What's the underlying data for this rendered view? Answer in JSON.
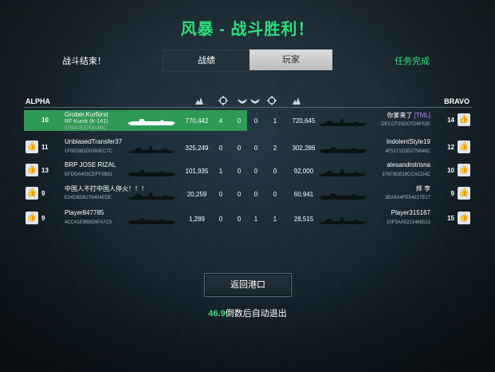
{
  "title": "风暴 - 战斗胜利！",
  "header": {
    "battle_over": "战斗结束！",
    "mission_complete": "任务完成",
    "tabs": [
      "战绩",
      "玩家"
    ]
  },
  "teams": {
    "left": "ALPHA",
    "right": "BRAVO"
  },
  "columns": [
    "damage-icon",
    "crosshair-icon",
    "wings-icon",
    "wings-icon",
    "crosshair-icon",
    "damage-icon"
  ],
  "rows": [
    {
      "left": {
        "rank": "10",
        "name": "Grober.Kurfürst",
        "ship": "RF Kursk (K-141)",
        "id": "676947E2758C69C",
        "score": "770,442",
        "s1": "4",
        "s2": "0"
      },
      "mid": "0",
      "right": {
        "s3": "1",
        "score": "720,645",
        "name": "你爹来了",
        "tag": "[TML]",
        "id": "DECCF25DCFD6F52E",
        "rank": "14"
      }
    },
    {
      "left": {
        "rank": "11",
        "name": "UnbiasedTransfer37",
        "ship": "",
        "id": "1F0ED6DD0390EC7C",
        "score": "325,249",
        "s1": "0",
        "s2": "0"
      },
      "mid": "0",
      "right": {
        "s3": "2",
        "score": "302,286",
        "name": "IndolentStyle19",
        "tag": "",
        "id": "4F5271D3D279848C",
        "rank": "12"
      }
    },
    {
      "left": {
        "rank": "13",
        "name": "BRP JOSE RIZAL",
        "ship": "",
        "id": "EFDDA403CEFF3B81",
        "score": "101,935",
        "s1": "1",
        "s2": "0"
      },
      "mid": "0",
      "right": {
        "s3": "0",
        "score": "92,000",
        "name": "alesandrotrisna",
        "tag": "",
        "id": "37879DE19CCACD4C",
        "rank": "10"
      }
    },
    {
      "left": {
        "rank": "9",
        "name": "中国人不打中国人停火！！！",
        "ship": "",
        "id": "E24D8DB276404EDE",
        "score": "20,259",
        "s1": "0",
        "s2": "0"
      },
      "mid": "0",
      "right": {
        "s3": "0",
        "score": "60,941",
        "name": "烨 李",
        "tag": "",
        "id": "3EA5A4FE54217E17",
        "rank": "9"
      }
    },
    {
      "left": {
        "rank": "9",
        "name": "Player847785",
        "ship": "",
        "id": "4CC41E9B8D9FA7C5",
        "score": "1,289",
        "s1": "0",
        "s2": "0"
      },
      "mid": "1",
      "right": {
        "s3": "1",
        "score": "28,515",
        "name": "Player315167",
        "tag": "",
        "id": "10F3AA5221486513",
        "rank": "15"
      }
    }
  ],
  "return_button": "返回港口",
  "countdown": {
    "seconds": "46.9",
    "text": "倒数后自动退出"
  },
  "colors": {
    "accent": "#2ee07a",
    "highlight_row": "#2f9a55"
  }
}
